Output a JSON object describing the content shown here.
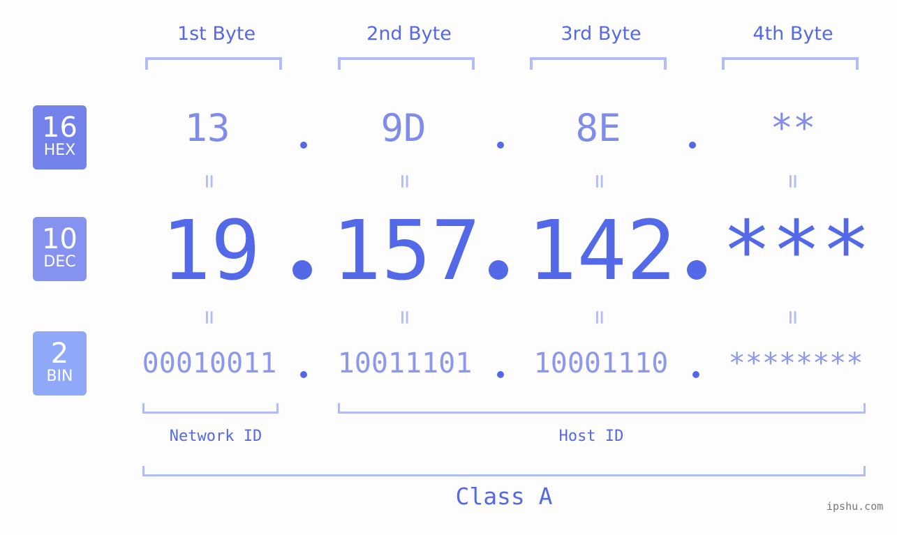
{
  "byte_headers": [
    "1st Byte",
    "2nd Byte",
    "3rd Byte",
    "4th Byte"
  ],
  "badges": [
    {
      "num": "16",
      "label": "HEX",
      "color": "#7382ea"
    },
    {
      "num": "10",
      "label": "DEC",
      "color": "#8592f0"
    },
    {
      "num": "2",
      "label": "BIN",
      "color": "#90a8f8"
    }
  ],
  "hex": [
    "13",
    "9D",
    "8E",
    "**"
  ],
  "dec": [
    "19",
    "157",
    "142",
    "***"
  ],
  "bin": [
    "00010011",
    "10011101",
    "10001110",
    "********"
  ],
  "equals_sign": "=",
  "network_label": "Network ID",
  "host_label": "Host ID",
  "class_label": "Class A",
  "watermark": "ipshu.com",
  "colors": {
    "accent": "#5469e8",
    "bracket": "#b2bcf8",
    "hex_text": "#7f8cea",
    "bin_text": "#8c97ee"
  }
}
